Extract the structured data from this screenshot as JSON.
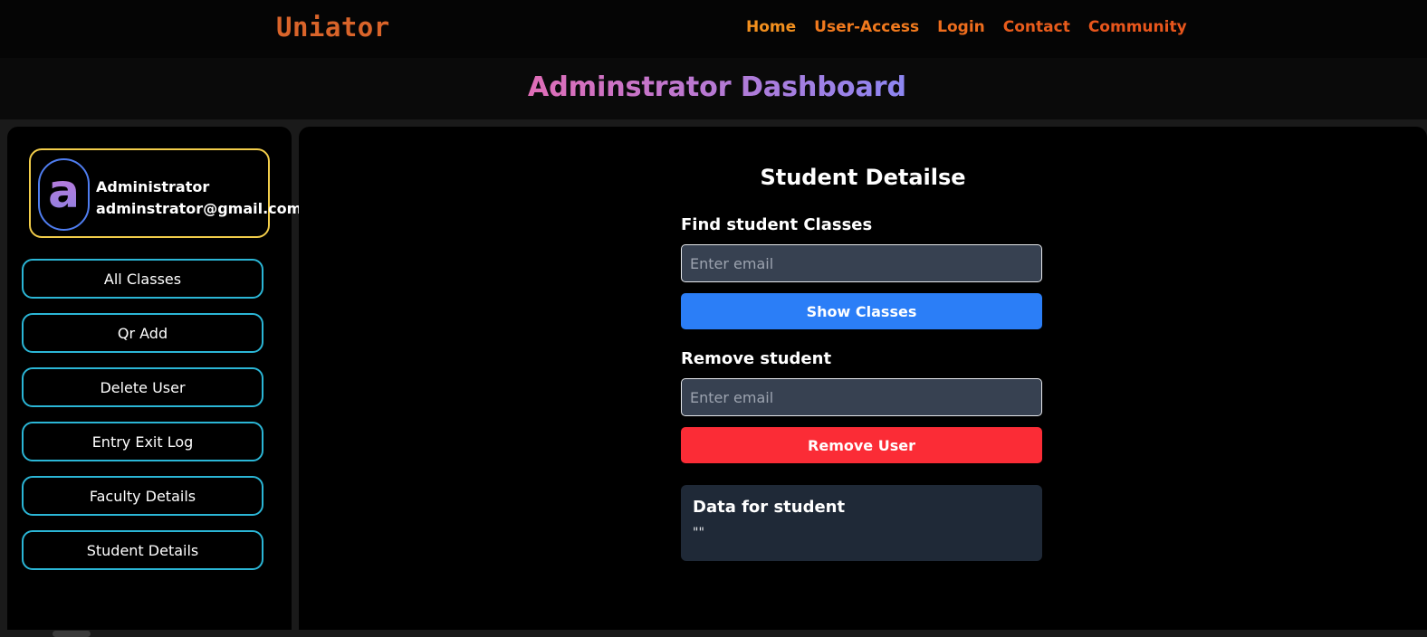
{
  "navbar": {
    "brand": "Uniator",
    "links": [
      "Home",
      "User-Access",
      "Login",
      "Contact",
      "Community"
    ]
  },
  "header": {
    "title": "Adminstrator Dashboard"
  },
  "profile": {
    "avatar_letter": "a",
    "name": "Administrator",
    "email": "adminstrator@gmail.com"
  },
  "sidebar": {
    "items": [
      "All Classes",
      "Qr Add",
      "Delete User",
      "Entry Exit Log",
      "Faculty Details",
      "Student Details"
    ]
  },
  "main": {
    "section_title": "Student Detailse",
    "find": {
      "label": "Find student Classes",
      "placeholder": "Enter email",
      "button": "Show Classes"
    },
    "remove": {
      "label": "Remove student",
      "placeholder": "Enter email",
      "button": "Remove User"
    },
    "result": {
      "title": "Data for student",
      "value": "\"\""
    }
  },
  "colors": {
    "brand": "#d9642a",
    "nav_link": "#f17a1e",
    "profile_border": "#f2cd4a",
    "sidebar_button_border": "#2bb6d6",
    "primary_button": "#2b7ef7",
    "danger_button": "#fb2c36"
  }
}
